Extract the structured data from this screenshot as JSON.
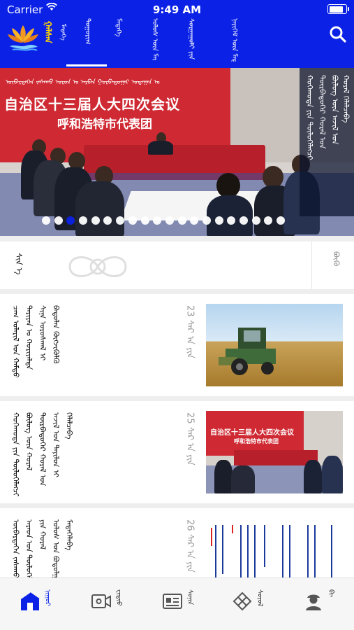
{
  "status_bar": {
    "carrier": "Carrier",
    "time": "9:49 AM",
    "battery_level": 0.95
  },
  "header": {
    "brand": "ᠭᠠᠯᠰᠠᠨ",
    "brand_sub": "ᠮᠡᠳᠡᠭᠡ",
    "nav": [
      "ᠲᠤᠭᠤᠷᠢᠭ",
      "ᠮᠡᠳᠡᠭᠡ",
      "ᠤᠯᠤᠰ ᠦᠨ ᠮᠡᠳᠡᠭᠡ",
      "ᠰᠤᠷᠭᠠᠭᠤᠯᠢ ᠶᠢᠨ ᠮᠡᠳᠡᠭᠡ",
      "ᠨᠡᠶᠢᠭᠡᠮ ᠦᠨ ᠮᠡᠳᠡᠭᠡ"
    ],
    "active_nav": 0
  },
  "banner": {
    "wall_mongolian": "ᠥᠪᠡᠷᠲᠡᠭᠡᠨ ᠵᠠᠰᠠᠬᠤ ᠣᠷᠤᠨ ᠤ ᠠᠷᠪᠠᠨ ᠭᠤᠷᠪᠠᠳᠤᠭᠠᠷ ᠤᠳᠠᠭᠠᠨ ᠤ",
    "wall_line1": "自治区十三届人大四次会议",
    "wall_line2": "呼和浩特市代表团",
    "caption": [
      "ᠬᠣᠬᠡᠬᠣᠲᠠ ᠶᠢᠨ ᠲᠥᠯᠥᠭᠡᠯᠡᠭᠴᠢ",
      "ᠳᠥᠷᠪᠡᠳᠦᠭᠡᠷ ᠬᠤᠷᠠᠯ ᠤᠨ",
      "ᠪᠦᠯᠦᠭ ᠦᠨ ᠠᠵᠢᠯ ᠤᠨ",
      "ᠬᠤᠷᠠᠯ ᠬᠡᠯᠡᠯᠴᠡᠪᠡ"
    ],
    "slide_count": 20,
    "active_slide": 2
  },
  "intro": {
    "title": "ᠰᠢᠨ ᠡ",
    "more": "ᠪᠦᠬᠦ"
  },
  "cards": [
    {
      "columns": [
        "ᠴᠠᠭ ᠤᠯᠠᠷᠢᠯ ᠤᠨ ᠬᠠᠮᠲᠤ",
        "ᠲᠠᠷᠢᠶᠠᠨ ᠤ ᠬᠤᠷᠢᠶᠠᠯᠲᠠ",
        "ᠰᠢᠨᠡ ᠤᠷᠤᠰᠬᠠᠯ ᠢ",
        "ᠪᠠᠲᠤᠯᠠᠨ ᠬᠥᠭᠵᠢᠭᠦᠯᠬᠦ"
      ],
      "date_day": "23",
      "date_month": "ᠰᠠᠷ ᠠ ᠶᠢᠨ",
      "thumb": "combine-harvester"
    },
    {
      "columns": [
        "ᠬᠣᠬᠡᠬᠣᠲᠠ ᠶᠢᠨ ᠲᠥᠯᠥᠭᠡᠯᠡᠭᠴᠢ",
        "ᠪᠦᠯᠦᠭ ᠦᠨ ᠬᠤᠷᠠᠯ",
        "ᠳᠥᠷᠪᠡᠳᠦᠭᠡᠷ ᠬᠤᠷᠠᠯ ᠤᠨ",
        "ᠠᠵᠢᠯ ᠤᠨ ᠲᠠᠶᠢᠯᠤᠨ ᠢ",
        "ᠬᠡᠯᠡᠯᠴᠡᠪᠡ"
      ],
      "date_day": "25",
      "date_month": "ᠰᠠᠷ ᠠ ᠶᠢᠨ",
      "thumb": "meeting-photo"
    },
    {
      "columns": [
        "ᠥᠪᠡᠷᠲᠡᠭᠡᠨ ᠵᠠᠰᠠᠬᠤ ᠣᠷᠤᠨ ᠤ",
        "ᠠᠷᠠᠳ ᠤᠨ ᠲᠥᠯᠥᠭᠡᠯᠡᠭᠴᠢ",
        "ᠶᠢᠨ ᠬᠤᠷᠠᠯ",
        "ᠤᠯᠤᠰ ᠤᠨ ᠪᠤᠳᠤᠯᠭᠠ",
        "ᠮᠡᠳᠡᠭᠡᠯᠡᠪᠡ"
      ],
      "date_day": "26",
      "date_month": "ᠰᠠᠷ ᠠ ᠶᠢᠨ",
      "thumb": "document-page"
    }
  ],
  "tabs": [
    {
      "label": "ᠨᠢᠭᠤᠷ",
      "icon": "home-icon",
      "active": true
    },
    {
      "label": "ᠸᠢᠳᠢᠣ",
      "icon": "video-icon",
      "active": false
    },
    {
      "label": "ᠰᠣᠨᠢᠨ",
      "icon": "newspaper-icon",
      "active": false
    },
    {
      "label": "ᠰᠣᠶᠣᠯ",
      "icon": "knot-icon",
      "active": false
    },
    {
      "label": "ᠪᠢ",
      "icon": "user-icon",
      "active": false
    }
  ],
  "colors": {
    "brand_blue": "#0b22e6",
    "banner_red": "#cf2a33",
    "brand_yellow": "#ffd400"
  }
}
